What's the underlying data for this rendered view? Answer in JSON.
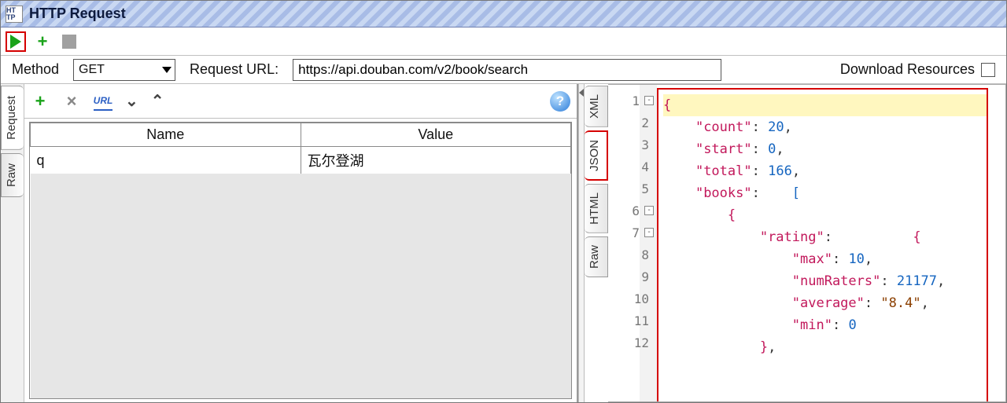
{
  "window": {
    "title": "HTTP Request",
    "icon_label": "HT\nTP"
  },
  "toolbar": {
    "run_label": "Run",
    "add_label": "Add",
    "stop_label": "Stop"
  },
  "request_bar": {
    "method_label": "Method",
    "method_value": "GET",
    "url_label": "Request URL:",
    "url_value": "https://api.douban.com/v2/book/search",
    "download_label": "Download Resources"
  },
  "left_tabs": [
    "Request",
    "Raw"
  ],
  "request_tools": {
    "add": "+",
    "delete": "×",
    "url_icon": "URL",
    "down": "⌄",
    "up": "⌃",
    "help": "?"
  },
  "param_table": {
    "headers": [
      "Name",
      "Value"
    ],
    "rows": [
      {
        "name": "q",
        "value": "瓦尔登湖"
      }
    ]
  },
  "response_tabs": [
    "XML",
    "JSON",
    "HTML",
    "Raw"
  ],
  "response_active_tab": "JSON",
  "json_lines": [
    {
      "n": 1,
      "fold": "-",
      "indent": 0,
      "tokens": [
        [
          "b",
          "{"
        ]
      ],
      "hl": true
    },
    {
      "n": 2,
      "indent": 1,
      "tokens": [
        [
          "k",
          "\"count\""
        ],
        [
          "pu",
          ": "
        ],
        [
          "n",
          "20"
        ],
        [
          "pu",
          ","
        ]
      ]
    },
    {
      "n": 3,
      "indent": 1,
      "tokens": [
        [
          "k",
          "\"start\""
        ],
        [
          "pu",
          ": "
        ],
        [
          "n",
          "0"
        ],
        [
          "pu",
          ","
        ]
      ]
    },
    {
      "n": 4,
      "indent": 1,
      "tokens": [
        [
          "k",
          "\"total\""
        ],
        [
          "pu",
          ": "
        ],
        [
          "n",
          "166"
        ],
        [
          "pu",
          ","
        ]
      ]
    },
    {
      "n": 5,
      "indent": 1,
      "tokens": [
        [
          "k",
          "\"books\""
        ],
        [
          "pu",
          ":    "
        ],
        [
          "br",
          "["
        ]
      ]
    },
    {
      "n": 6,
      "fold": "-",
      "indent": 2,
      "tokens": [
        [
          "b",
          "{"
        ]
      ]
    },
    {
      "n": 7,
      "fold": "-",
      "indent": 3,
      "tokens": [
        [
          "k",
          "\"rating\""
        ],
        [
          "pu",
          ":          "
        ],
        [
          "b",
          "{"
        ]
      ]
    },
    {
      "n": 8,
      "indent": 4,
      "tokens": [
        [
          "k",
          "\"max\""
        ],
        [
          "pu",
          ": "
        ],
        [
          "n",
          "10"
        ],
        [
          "pu",
          ","
        ]
      ]
    },
    {
      "n": 9,
      "indent": 4,
      "tokens": [
        [
          "k",
          "\"numRaters\""
        ],
        [
          "pu",
          ": "
        ],
        [
          "n",
          "21177"
        ],
        [
          "pu",
          ","
        ]
      ]
    },
    {
      "n": 10,
      "indent": 4,
      "tokens": [
        [
          "k",
          "\"average\""
        ],
        [
          "pu",
          ": "
        ],
        [
          "s",
          "\"8.4\""
        ],
        [
          "pu",
          ","
        ]
      ]
    },
    {
      "n": 11,
      "indent": 4,
      "tokens": [
        [
          "k",
          "\"min\""
        ],
        [
          "pu",
          ": "
        ],
        [
          "n",
          "0"
        ]
      ]
    },
    {
      "n": 12,
      "indent": 3,
      "tokens": [
        [
          "b",
          "}"
        ],
        [
          "pu",
          ","
        ]
      ]
    }
  ]
}
